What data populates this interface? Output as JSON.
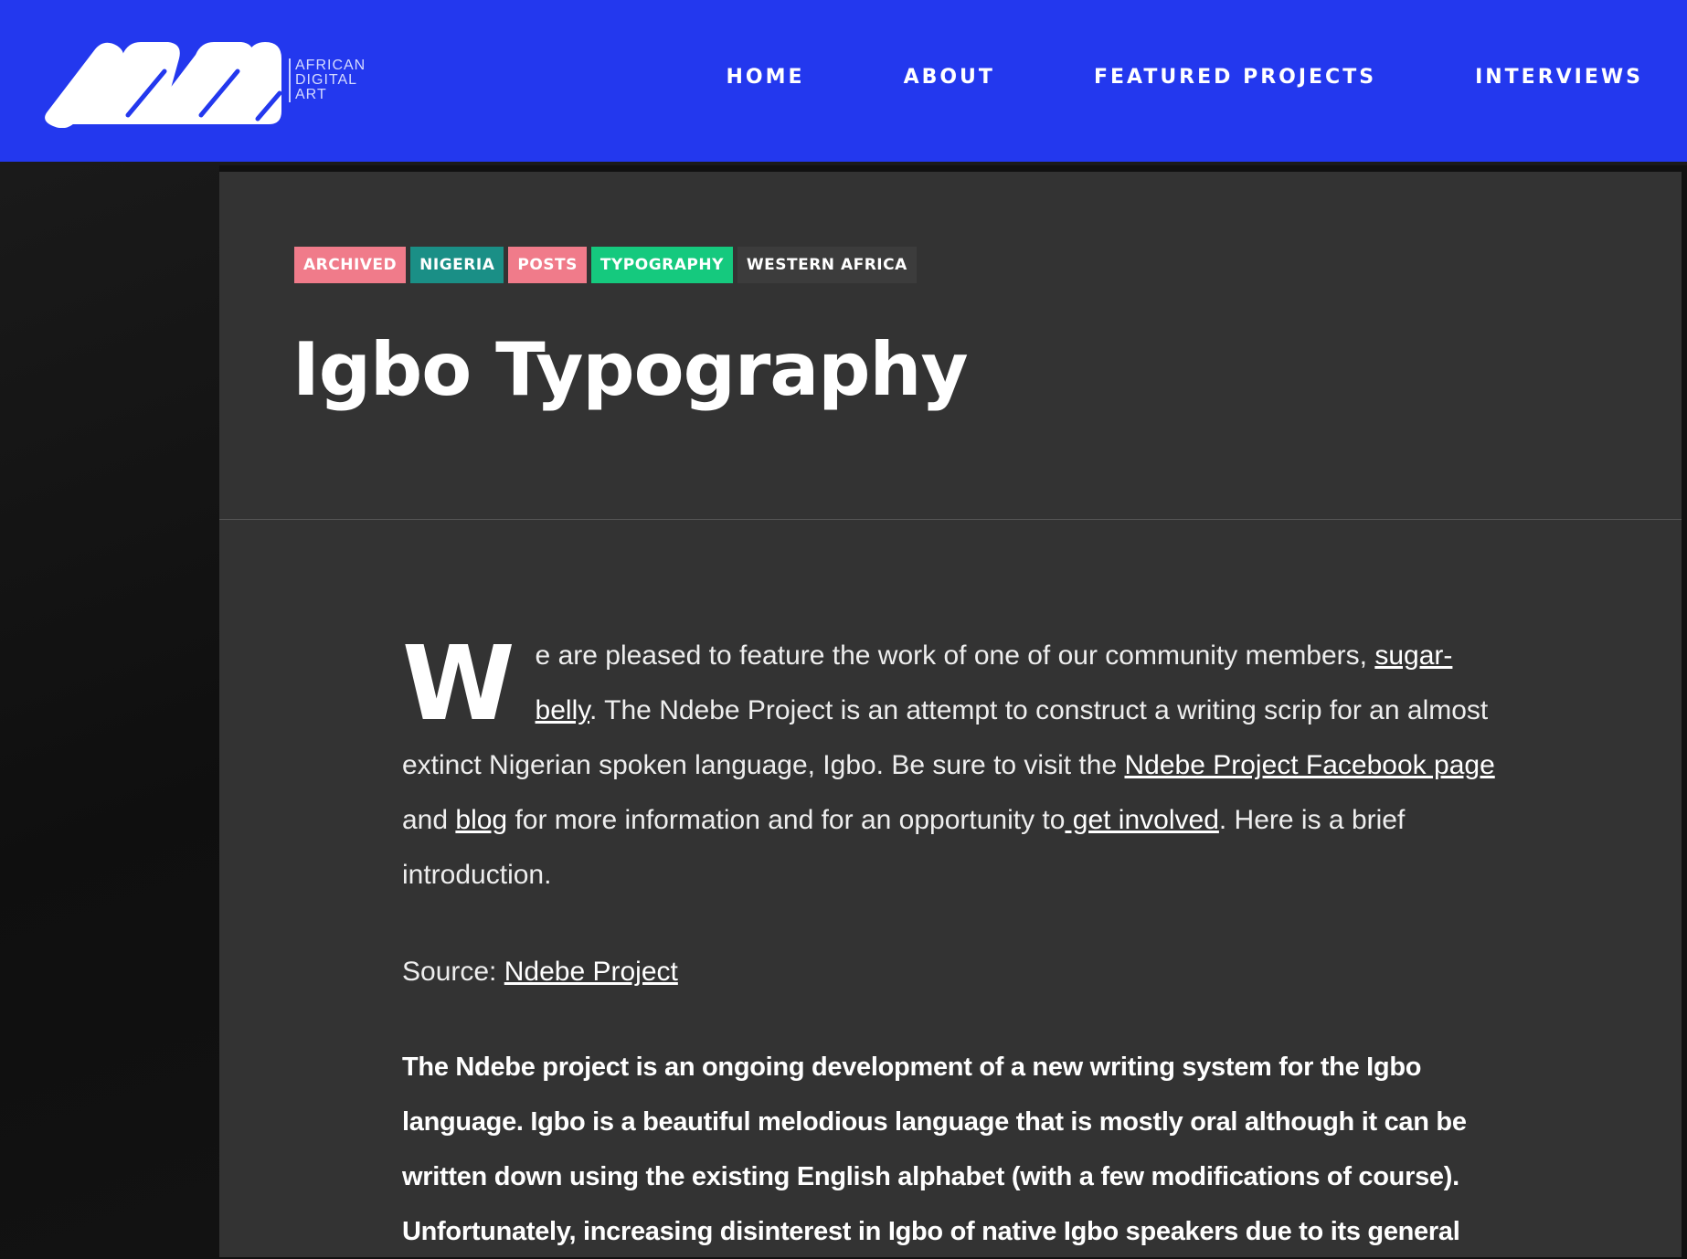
{
  "header": {
    "logo_alt_lines": [
      "AFRICAN",
      "DIGITAL",
      "ART"
    ],
    "nav": [
      {
        "label": "HOME"
      },
      {
        "label": "ABOUT"
      },
      {
        "label": "FEATURED PROJECTS"
      },
      {
        "label": "INTERVIEWS"
      }
    ],
    "brand_color": "#2338ee"
  },
  "article": {
    "tags": [
      {
        "label": "ARCHIVED",
        "color": "#f07b8a"
      },
      {
        "label": "NIGERIA",
        "color": "#1a8f86"
      },
      {
        "label": "POSTS",
        "color": "#f07b8a"
      },
      {
        "label": "TYPOGRAPHY",
        "color": "#15c97e"
      },
      {
        "label": "WESTERN AFRICA",
        "color": "#3c3c3c"
      }
    ],
    "title": "Igbo Typography",
    "intro": {
      "dropcap": "W",
      "t1": "e are pleased to feature the work of one of our community members, ",
      "link1": "sugar-belly",
      "t2": ". The Ndebe Project is an attempt to construct a writing scrip for an almost extinct Nigerian spoken language, Igbo. Be sure to visit the ",
      "link2": "Ndebe Project Facebook page",
      "t3": " and ",
      "link3": "blog",
      "t4": " for more information and for an opportunity to",
      "link4": " get involved",
      "t5": ".  Here is a brief introduction."
    },
    "source": {
      "label": "Source: ",
      "link": "Ndebe Project"
    },
    "paragraph": "The Ndebe project is an ongoing development of a new writing system for the Igbo language. Igbo is a beautiful melodious language that is mostly oral although it can be written down using the existing English alphabet (with a few modifications of course). Unfortunately, increasing disinterest in Igbo of native Igbo speakers due to its general"
  }
}
